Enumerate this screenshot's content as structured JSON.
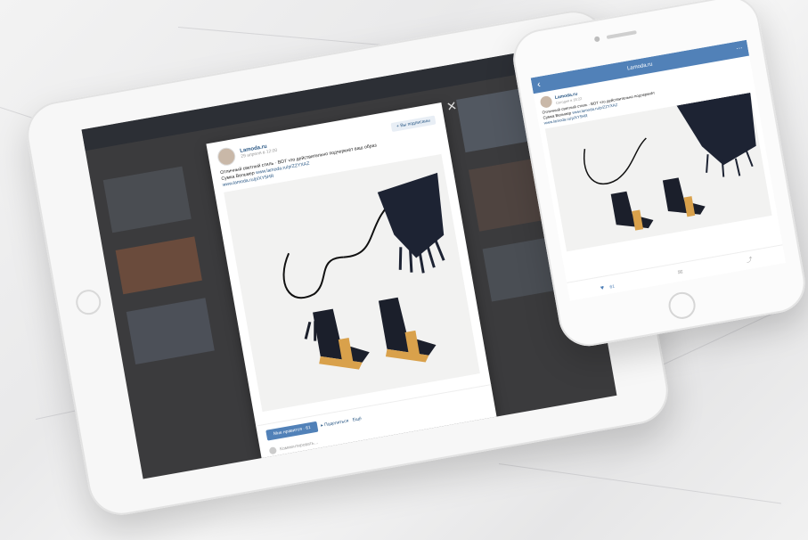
{
  "tablet": {
    "close_icon": "✕",
    "post": {
      "author": "Lamoda.ru",
      "date": "29 апреля в 12:00",
      "subscribe_label": "+ Вы подписаны",
      "text_line1": "Отличный светлый стиль · ВОТ что действительно подчеркнёт ваш образ",
      "link1": "www.lamoda.ru/p/ZZYXAZ",
      "text_line2": "Сумка Вельмер",
      "link2": "www.lamoda.ru/p/XY5HR",
      "like_label": "Мне нравится · 61",
      "share_label": "▸ Поделиться",
      "more_label": "Ещё",
      "comment_placeholder": "Комментировать…"
    }
  },
  "phone": {
    "nav_title": "Lamoda.ru",
    "back_icon": "‹",
    "menu_icon": "⋯",
    "post": {
      "author": "Lamoda.ru",
      "date": "Сегодня в 18:22",
      "text_line1": "Отличный светлый стиль · ВОТ что действительно подчеркнёт",
      "text_line2": "Сумка Вельмер",
      "link1": "www.lamoda.ru/p/ZZYXAZ",
      "link2": "www.lamoda.ru/p/XY5HR",
      "like_icon": "♥",
      "like_count": "61",
      "comment_icon": "✉",
      "share_icon": "⤴"
    }
  }
}
